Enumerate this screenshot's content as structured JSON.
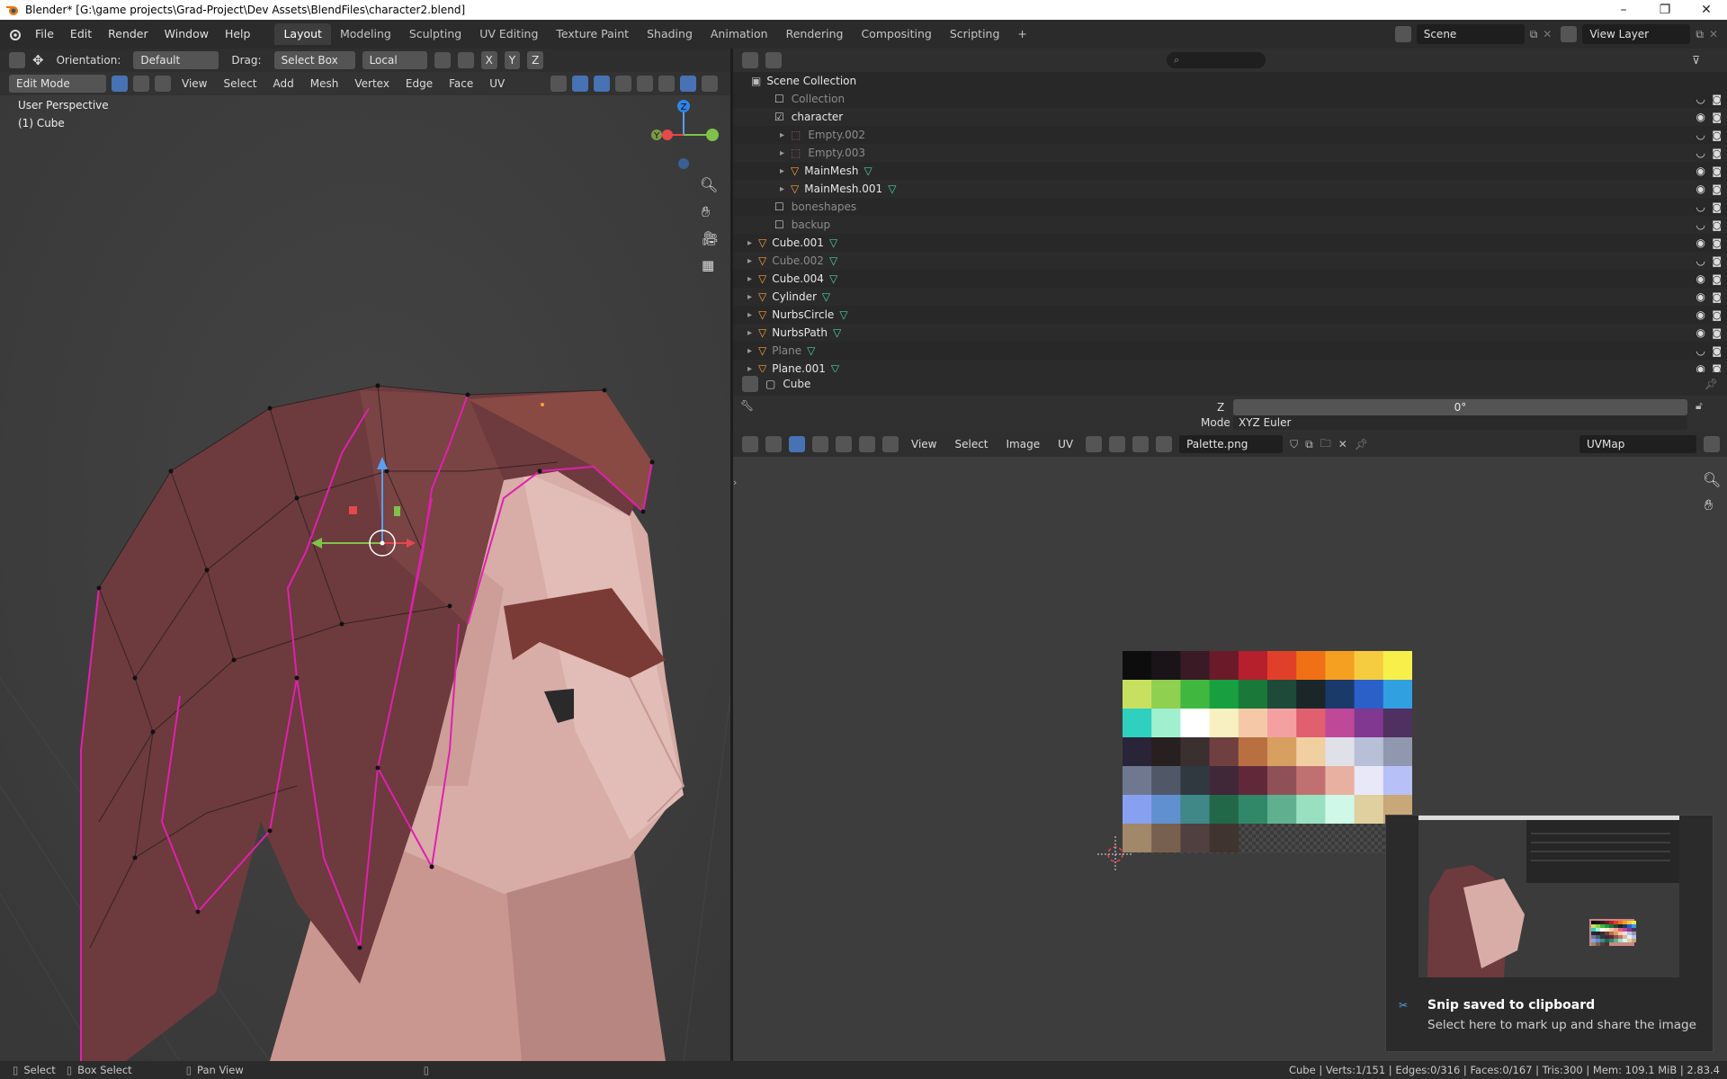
{
  "window": {
    "title": "Blender* [G:\\game projects\\Grad-Project\\Dev Assets\\BlendFiles\\character2.blend]",
    "controls": [
      "–",
      "❐",
      "✕"
    ]
  },
  "menu": [
    "File",
    "Edit",
    "Render",
    "Window",
    "Help"
  ],
  "workspaces": [
    "Layout",
    "Modeling",
    "Sculpting",
    "UV Editing",
    "Texture Paint",
    "Shading",
    "Animation",
    "Rendering",
    "Compositing",
    "Scripting"
  ],
  "active_workspace": "Layout",
  "add_workspace": "+",
  "scene": {
    "name": "Scene",
    "view_layer": "View Layer"
  },
  "viewport": {
    "orientation_label": "Orientation:",
    "orientation_value": "Default",
    "drag_label": "Drag:",
    "drag_value": "Select Box",
    "pivot_value": "Local",
    "axes": [
      "X",
      "Y",
      "Z"
    ],
    "mode": "Edit Mode",
    "header_menus": [
      "View",
      "Select",
      "Add",
      "Mesh",
      "Vertex",
      "Edge",
      "Face",
      "UV"
    ],
    "overlay_title": "User Perspective",
    "overlay_object": "(1) Cube",
    "gizmo_axis_z": "Z",
    "gizmo_axis_y": "Y"
  },
  "outliner": {
    "search_placeholder": "",
    "root": "Scene Collection",
    "rows": [
      {
        "name": "Collection",
        "dim": true,
        "type": "collection",
        "indent": 1
      },
      {
        "name": "character",
        "dim": false,
        "type": "collection",
        "indent": 1,
        "checked": true
      },
      {
        "name": "Empty.002",
        "dim": true,
        "type": "empty",
        "indent": 2
      },
      {
        "name": "Empty.003",
        "dim": true,
        "type": "empty",
        "indent": 2
      },
      {
        "name": "MainMesh",
        "dim": false,
        "type": "mesh",
        "indent": 2
      },
      {
        "name": "MainMesh.001",
        "dim": false,
        "type": "mesh",
        "indent": 2
      },
      {
        "name": "boneshapes",
        "dim": true,
        "type": "collection",
        "indent": 1
      },
      {
        "name": "backup",
        "dim": true,
        "type": "collection",
        "indent": 1
      },
      {
        "name": "Cube.001",
        "dim": false,
        "type": "mesh",
        "indent": 0
      },
      {
        "name": "Cube.002",
        "dim": true,
        "type": "mesh",
        "indent": 0
      },
      {
        "name": "Cube.004",
        "dim": false,
        "type": "mesh",
        "indent": 0
      },
      {
        "name": "Cylinder",
        "dim": false,
        "type": "mesh",
        "indent": 0
      },
      {
        "name": "NurbsCircle",
        "dim": false,
        "type": "mesh",
        "indent": 0
      },
      {
        "name": "NurbsPath",
        "dim": false,
        "type": "mesh",
        "indent": 0
      },
      {
        "name": "Plane",
        "dim": true,
        "type": "mesh",
        "indent": 0
      },
      {
        "name": "Plane.001",
        "dim": false,
        "type": "mesh",
        "indent": 0
      }
    ]
  },
  "properties": {
    "object_name": "Cube",
    "z_label": "Z",
    "z_value": "0°",
    "mode_label": "Mode",
    "mode_value": "XYZ Euler"
  },
  "image_editor": {
    "menus": [
      "View",
      "Select",
      "Image",
      "UV"
    ],
    "image_name": "Palette.png",
    "uvmap": "UVMap"
  },
  "palette": [
    [
      "#0d0d0d",
      "#1a1418",
      "#3a1a24",
      "#6b1a2a",
      "#b5202c",
      "#e0402a",
      "#f07015",
      "#f5a020",
      "#f5cc40",
      "#f8f04a"
    ],
    [
      "#c8e060",
      "#90d050",
      "#40b840",
      "#18a040",
      "#1a7838",
      "#1e4a3a",
      "#1a2628",
      "#1a3a6a",
      "#2a60c8",
      "#30a0e0"
    ],
    [
      "#30d0c0",
      "#a0f0d0",
      "#ffffff",
      "#f8f0c0",
      "#f5c8a8",
      "#f5a0a0",
      "#e06070",
      "#c04898",
      "#803890",
      "#503060"
    ],
    [
      "#2a2438",
      "#282020",
      "#3a3030",
      "#704040",
      "#b87040",
      "#d8a060",
      "#f0d0a0",
      "#e0e0e8",
      "#b8c0d8",
      "#9098b0"
    ],
    [
      "#707890",
      "#505868",
      "#303840",
      "#402838",
      "#602838",
      "#905058",
      "#c07070",
      "#e8b0a0",
      "#e8e8f8",
      "#b8c0f8"
    ],
    [
      "#88a0f0",
      "#6090d0",
      "#408888",
      "#206848",
      "#308868",
      "#60b090",
      "#98e0c0",
      "#d0f8e8",
      "#e0d0a0",
      "#c8a878"
    ],
    [
      "#a08868",
      "#786050",
      "#504040",
      "#403430"
    ]
  ],
  "notification": {
    "title": "Snip saved to clipboard",
    "body": "Select here to mark up and share the image"
  },
  "statusbar": {
    "select": "Select",
    "box_select": "Box Select",
    "pan_view": "Pan View",
    "stats": "Cube | Verts:1/151 | Edges:0/316 | Faces:0/167 | Tris:300 | Mem: 109.1 MiB | 2.83.4"
  },
  "colors": {
    "accent": "#4772b3",
    "selected_edge": "#e020b0",
    "hair": "#6d3a3d",
    "skin": "#d7aaa6"
  }
}
